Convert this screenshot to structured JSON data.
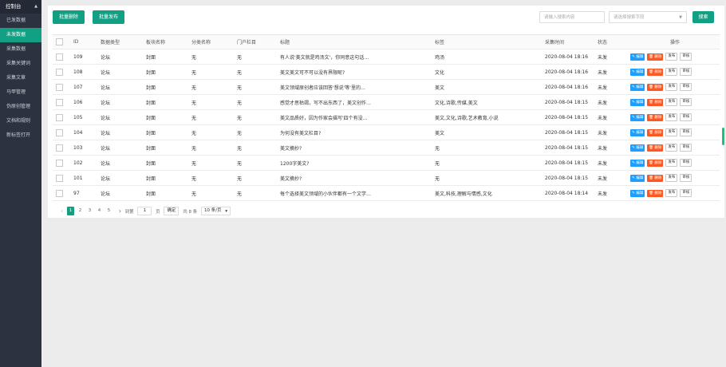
{
  "sidebar": {
    "title": "控制台",
    "items": [
      {
        "label": "已发数据",
        "active": false
      },
      {
        "label": "未发数据",
        "active": true
      },
      {
        "label": "采集数据",
        "active": false
      },
      {
        "label": "采集关键词",
        "active": false
      },
      {
        "label": "采集文章",
        "active": false
      },
      {
        "label": "马甲管理",
        "active": false
      },
      {
        "label": "伪原创管理",
        "active": false
      },
      {
        "label": "文档和规则",
        "active": false
      },
      {
        "label": "新标签打开",
        "active": false
      }
    ]
  },
  "toolbar": {
    "batch_delete": "批量删除",
    "batch_publish": "批量发布",
    "search_placeholder": "请输入搜索内容",
    "field_placeholder": "请选择搜索字段",
    "search_button": "搜索"
  },
  "table": {
    "columns": [
      "ID",
      "数据类型",
      "板块名称",
      "分类名称",
      "门户栏目",
      "标题",
      "标签",
      "采集时间",
      "状态",
      "操作"
    ],
    "rows": [
      {
        "id": "109",
        "type": "论坛",
        "board": "封面",
        "category": "无",
        "portal": "无",
        "title": "有人说'美文就是鸡汤文'，你同意这句话…",
        "tags": "鸡汤",
        "time": "2020-08-04 18:16",
        "status": "未发"
      },
      {
        "id": "108",
        "type": "论坛",
        "board": "封面",
        "category": "无",
        "portal": "无",
        "title": "美文美文可不可以没有界限呢?",
        "tags": "文化",
        "time": "2020-08-04 18:16",
        "status": "未发"
      },
      {
        "id": "107",
        "type": "论坛",
        "board": "封面",
        "category": "无",
        "portal": "无",
        "title": "美文领域原创者应该回答'想说'等'里的…",
        "tags": "美文",
        "time": "2020-08-04 18:16",
        "status": "未发"
      },
      {
        "id": "106",
        "type": "论坛",
        "board": "封面",
        "category": "无",
        "portal": "无",
        "title": "感觉才思枯竭，写不出东西了，美文创作…",
        "tags": "文化,诗歌,传媒,美文",
        "time": "2020-08-04 18:15",
        "status": "未发"
      },
      {
        "id": "105",
        "type": "论坛",
        "board": "封面",
        "category": "无",
        "portal": "无",
        "title": "美文品质好，因为作家会描写'四个有没…",
        "tags": "美文,文化,诗歌,艺术教育,小说",
        "time": "2020-08-04 18:15",
        "status": "未发"
      },
      {
        "id": "104",
        "type": "论坛",
        "board": "封面",
        "category": "无",
        "portal": "无",
        "title": "为何没有美文栏目?",
        "tags": "美文",
        "time": "2020-08-04 18:15",
        "status": "未发"
      },
      {
        "id": "103",
        "type": "论坛",
        "board": "封面",
        "category": "无",
        "portal": "无",
        "title": "美文摘抄?",
        "tags": "无",
        "time": "2020-08-04 18:15",
        "status": "未发"
      },
      {
        "id": "102",
        "type": "论坛",
        "board": "封面",
        "category": "无",
        "portal": "无",
        "title": "1200字美文?",
        "tags": "无",
        "time": "2020-08-04 18:15",
        "status": "未发"
      },
      {
        "id": "101",
        "type": "论坛",
        "board": "封面",
        "category": "无",
        "portal": "无",
        "title": "美文摘抄?",
        "tags": "无",
        "time": "2020-08-04 18:15",
        "status": "未发"
      },
      {
        "id": "97",
        "type": "论坛",
        "board": "封面",
        "category": "无",
        "portal": "无",
        "title": "每个选择美文领域的小伙伴都有一个文学…",
        "tags": "美文,科技,理解与情感,文化",
        "time": "2020-08-04 18:14",
        "status": "未发"
      }
    ],
    "actions": {
      "edit": "✎ 编辑",
      "delete": "🗑 删除",
      "publish": "发布",
      "review": "审核"
    }
  },
  "pager": {
    "prev": "‹",
    "pages": [
      "1",
      "2",
      "3",
      "4",
      "5"
    ],
    "current": "1",
    "next": "›",
    "goto_label": "到第",
    "goto_value": "1",
    "page_unit": "页",
    "confirm": "确定",
    "total": "共 8 条",
    "page_size": "10 条/页"
  }
}
